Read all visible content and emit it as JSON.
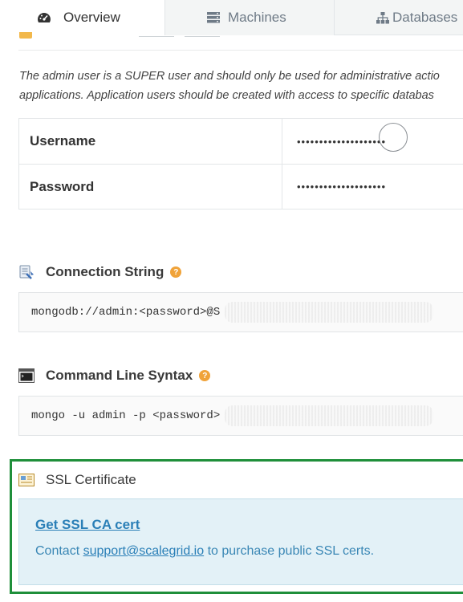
{
  "tabs": [
    {
      "label": "Overview",
      "icon": "dashboard-icon",
      "active": true
    },
    {
      "label": "Machines",
      "icon": "server-icon",
      "active": false
    },
    {
      "label": "Databases",
      "icon": "sitemap-icon",
      "active": false
    }
  ],
  "admin_note": {
    "line1": "The admin user is a SUPER user and should only be used for administrative actio",
    "line2": "applications. Application users should be created with access to specific databas"
  },
  "credentials": {
    "username_label": "Username",
    "username_value": "••••••••••••••••••••",
    "password_label": "Password",
    "password_value": "••••••••••••••••••••"
  },
  "connection_string": {
    "title": "Connection String",
    "help": "?",
    "value": "mongodb://admin:<password>@S"
  },
  "command_line": {
    "title": "Command Line Syntax",
    "help": "?",
    "value": "mongo -u admin -p <password>"
  },
  "ssl": {
    "title": "SSL Certificate",
    "link": "Get SSL CA cert",
    "text_before": "Contact ",
    "email": "support@scalegrid.io",
    "text_after": " to purchase public SSL certs."
  },
  "colors": {
    "accent_link": "#2a7fb7",
    "highlight_frame": "#1f8f3a",
    "help_badge": "#f0a33a",
    "info_panel": "#e3f1f7"
  }
}
